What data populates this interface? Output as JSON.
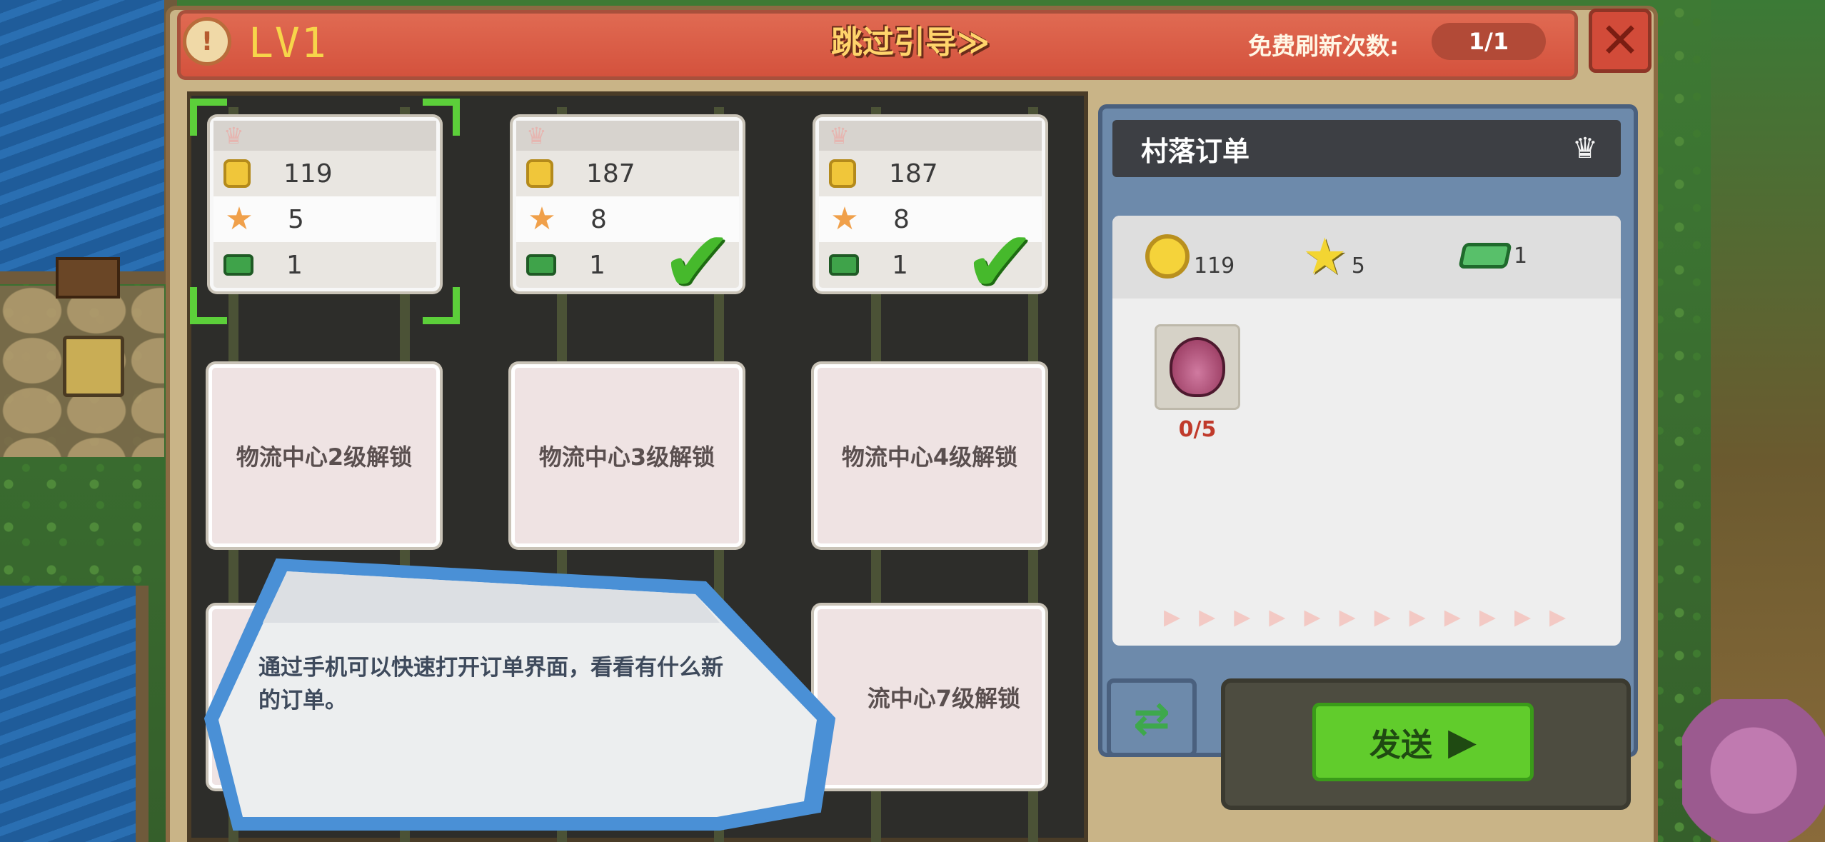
{
  "header": {
    "level": "LV1",
    "skip_guide": "跳过引导≫",
    "refresh_label": "免费刷新次数:",
    "refresh_count": "1/1",
    "close": "✕"
  },
  "orders": [
    {
      "coins": "119",
      "stars": "5",
      "cash": "1",
      "selected": true,
      "completed": false
    },
    {
      "coins": "187",
      "stars": "8",
      "cash": "1",
      "selected": false,
      "completed": true
    },
    {
      "coins": "187",
      "stars": "8",
      "cash": "1",
      "selected": false,
      "completed": true
    }
  ],
  "locked_slots": {
    "slot2": "物流中心2级解锁",
    "slot3": "物流中心3级解锁",
    "slot4": "物流中心4级解锁",
    "slot7": "流中心7级解锁"
  },
  "detail": {
    "title": "村落订单",
    "rewards": {
      "coins": "119",
      "stars": "5",
      "cash": "1"
    },
    "item_progress": "0/5",
    "item_icon": "onion-icon"
  },
  "send_label": "发送",
  "tutorial": {
    "text_line1": "通过手机可以快速打开订单界面，看看有什么新",
    "text_line2": "的订单。"
  },
  "colors": {
    "title_bar": "#d4523d",
    "level_text": "#f7d54a",
    "send_button": "#61cc2c",
    "progress_red": "#c03a2b",
    "detail_frame": "#6d8aab"
  }
}
